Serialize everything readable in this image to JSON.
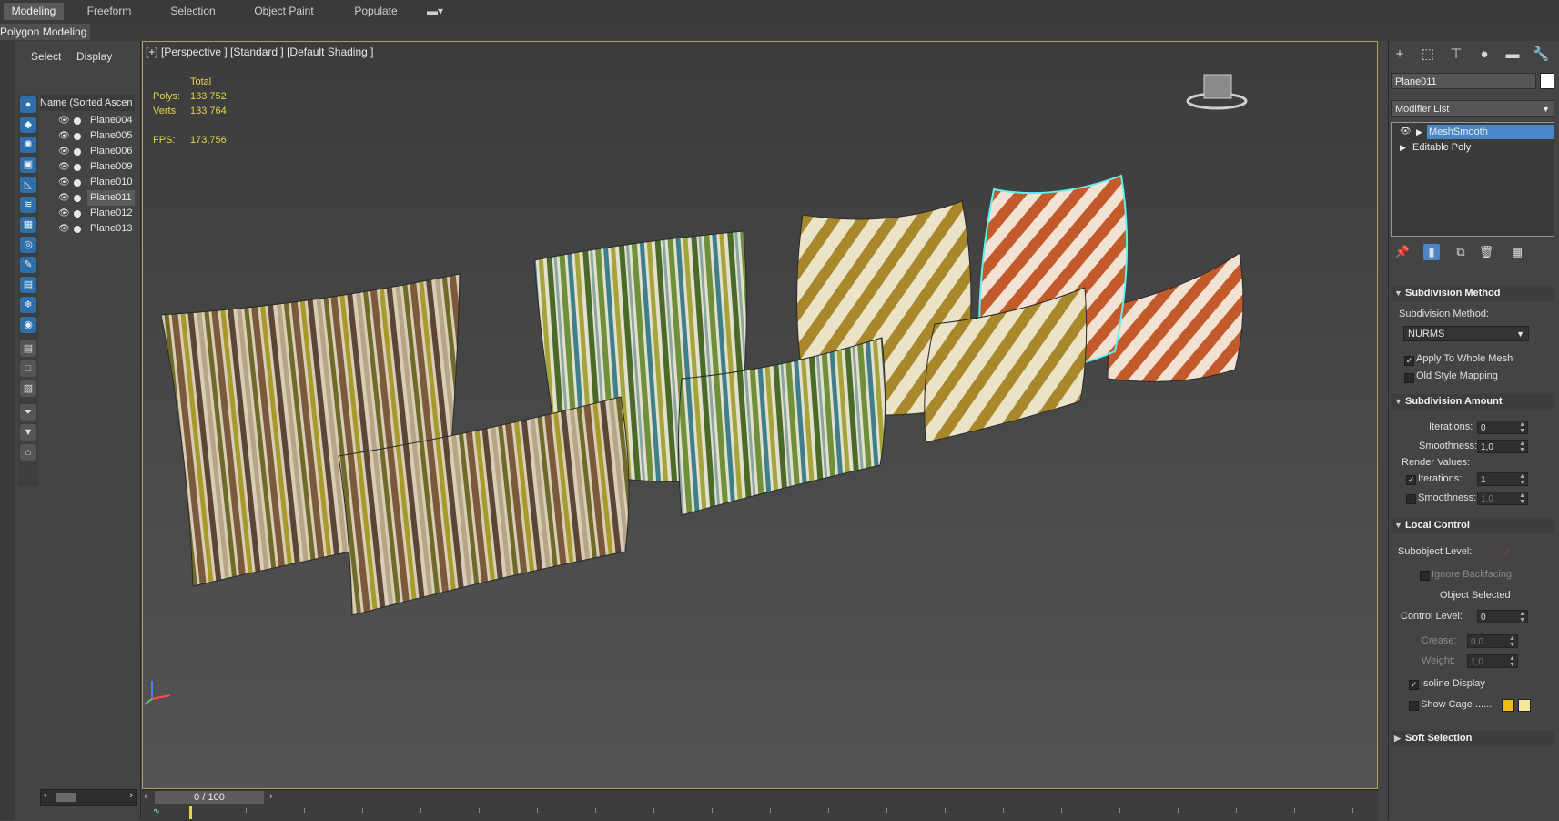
{
  "ribbon": {
    "tabs": [
      "Modeling",
      "Freeform",
      "Selection",
      "Object Paint",
      "Populate"
    ],
    "active_tab": "Modeling",
    "sub_label": "Polygon Modeling"
  },
  "scene_explorer": {
    "tabs": [
      "Select",
      "Display"
    ],
    "column_header": "Name (Sorted Ascen",
    "items": [
      {
        "name": "Plane004",
        "selected": false
      },
      {
        "name": "Plane005",
        "selected": false
      },
      {
        "name": "Plane006",
        "selected": false
      },
      {
        "name": "Plane009",
        "selected": false
      },
      {
        "name": "Plane010",
        "selected": false
      },
      {
        "name": "Plane011",
        "selected": true
      },
      {
        "name": "Plane012",
        "selected": false
      },
      {
        "name": "Plane013",
        "selected": false
      }
    ]
  },
  "viewport": {
    "label": "[+] [Perspective ] [Standard ] [Default Shading ]",
    "stats": {
      "total_label": "Total",
      "polys_label": "Polys:",
      "polys_value": "133 752",
      "verts_label": "Verts:",
      "verts_value": "133 764",
      "fps_label": "FPS:",
      "fps_value": "173,756"
    }
  },
  "command_panel": {
    "object_name": "Plane011",
    "modifier_list": "Modifier List",
    "stack": [
      "MeshSmooth",
      "Editable Poly"
    ],
    "subdivision_method": {
      "title": "Subdivision Method",
      "method_label": "Subdivision Method:",
      "method_value": "NURMS",
      "apply_whole_mesh": "Apply To Whole Mesh",
      "old_style_mapping": "Old Style Mapping"
    },
    "subdivision_amount": {
      "title": "Subdivision Amount",
      "iterations_label": "Iterations:",
      "iterations_value": "0",
      "smoothness_label": "Smoothness:",
      "smoothness_value": "1,0",
      "render_values_label": "Render Values:",
      "render_iterations_label": "Iterations:",
      "render_iterations_value": "1",
      "render_smoothness_label": "Smoothness:",
      "render_smoothness_value": "1,0"
    },
    "local_control": {
      "title": "Local Control",
      "subobject_label": "Subobject Level:",
      "ignore_backfacing": "Ignore Backfacing",
      "object_selected": "Object Selected",
      "control_level_label": "Control Level:",
      "control_level_value": "0",
      "crease_label": "Crease:",
      "crease_value": "0,0",
      "weight_label": "Weight:",
      "weight_value": "1,0",
      "isoline_display": "Isoline Display",
      "show_cage": "Show Cage ......"
    },
    "soft_selection": {
      "title": "Soft Selection"
    }
  },
  "timeline": {
    "frame_label": "0 / 100"
  },
  "colors": {
    "accent_blue": "#4a86c7",
    "stat_yellow": "#e8d44a",
    "cage_color_1": "#f2b91f",
    "cage_color_2": "#f2e79a",
    "selection_cyan": "#5ff2f0"
  }
}
